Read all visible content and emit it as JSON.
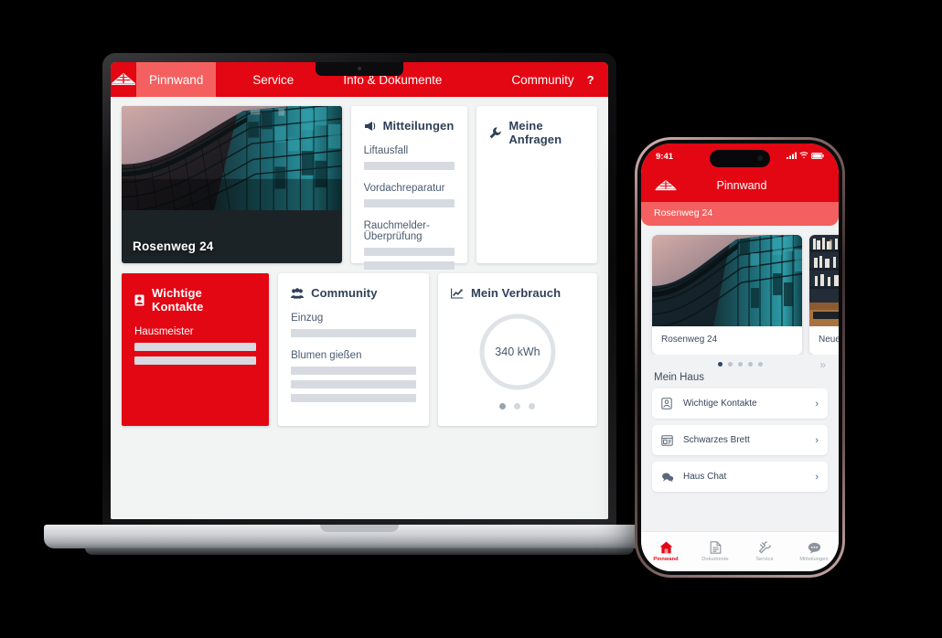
{
  "brand": {
    "red": "#e30613",
    "red_light": "#f4605f",
    "navy": "#2f4058",
    "logo_name": "roof-logo"
  },
  "desktop": {
    "nav": {
      "tabs": [
        {
          "label": "Pinnwand",
          "active": true
        },
        {
          "label": "Service",
          "active": false
        },
        {
          "label": "Info & Dokumente",
          "active": false
        },
        {
          "label": "Community",
          "active": false
        }
      ],
      "icons": [
        {
          "name": "help-icon",
          "glyph": "?"
        },
        {
          "name": "chat-icon",
          "glyph": ""
        },
        {
          "name": "mail-icon",
          "glyph": ""
        },
        {
          "name": "user-icon",
          "glyph": ""
        }
      ]
    },
    "hero": {
      "caption": "Rosenweg 24"
    },
    "cards": {
      "mitteilungen": {
        "title": "Mitteilungen",
        "icon": "megaphone-icon",
        "items": [
          {
            "label": "Liftausfall",
            "lines": 1
          },
          {
            "label": "Vordachreparatur",
            "lines": 1
          },
          {
            "label": "Rauchmelder-Überprüfung",
            "lines": 2
          }
        ]
      },
      "anfragen": {
        "title": "Meine Anfragen",
        "icon": "wrench-icon"
      },
      "kontakte": {
        "title": "Wichtige Kontakte",
        "icon": "contact-card-icon",
        "items": [
          {
            "label": "Hausmeister",
            "lines": 2
          }
        ]
      },
      "community": {
        "title": "Community",
        "icon": "people-icon",
        "items": [
          {
            "label": "Einzug",
            "lines": 1
          },
          {
            "label": "Blumen gießen",
            "lines": 3
          }
        ]
      },
      "verbrauch": {
        "title": "Mein Verbrauch",
        "icon": "chart-line-icon",
        "gauge_value": "340 kWh",
        "dots": [
          true,
          false,
          false
        ]
      }
    }
  },
  "phone": {
    "status": {
      "time": "9:41",
      "signal": "signal-icon",
      "wifi": "wifi-icon",
      "battery": "battery-icon"
    },
    "header": {
      "title": "Pinnwand",
      "logo": "roof-logo"
    },
    "house_bar": "Rosenweg 24",
    "carousel": [
      {
        "label": "Rosenweg 24",
        "image": "building-facade-photo"
      },
      {
        "label": "Neues",
        "image": "bookshelf-photo"
      }
    ],
    "pager": {
      "dots": [
        true,
        false,
        false,
        false,
        false
      ],
      "next": "»"
    },
    "section_title": "Mein Haus",
    "menu": [
      {
        "label": "Wichtige Kontakte",
        "icon": "contact-card-icon",
        "chevron": "›"
      },
      {
        "label": "Schwarzes Brett",
        "icon": "bulletin-board-icon",
        "chevron": "›"
      },
      {
        "label": "Haus Chat",
        "icon": "chat-bubbles-icon",
        "chevron": "›"
      }
    ],
    "tabbar": [
      {
        "label": "Pinnwand",
        "icon": "home-icon",
        "active": true
      },
      {
        "label": "Dokumente",
        "icon": "document-icon",
        "active": false
      },
      {
        "label": "Service",
        "icon": "tools-icon",
        "active": false
      },
      {
        "label": "Mitteilungen",
        "icon": "speech-bubble-icon",
        "active": false
      }
    ]
  }
}
